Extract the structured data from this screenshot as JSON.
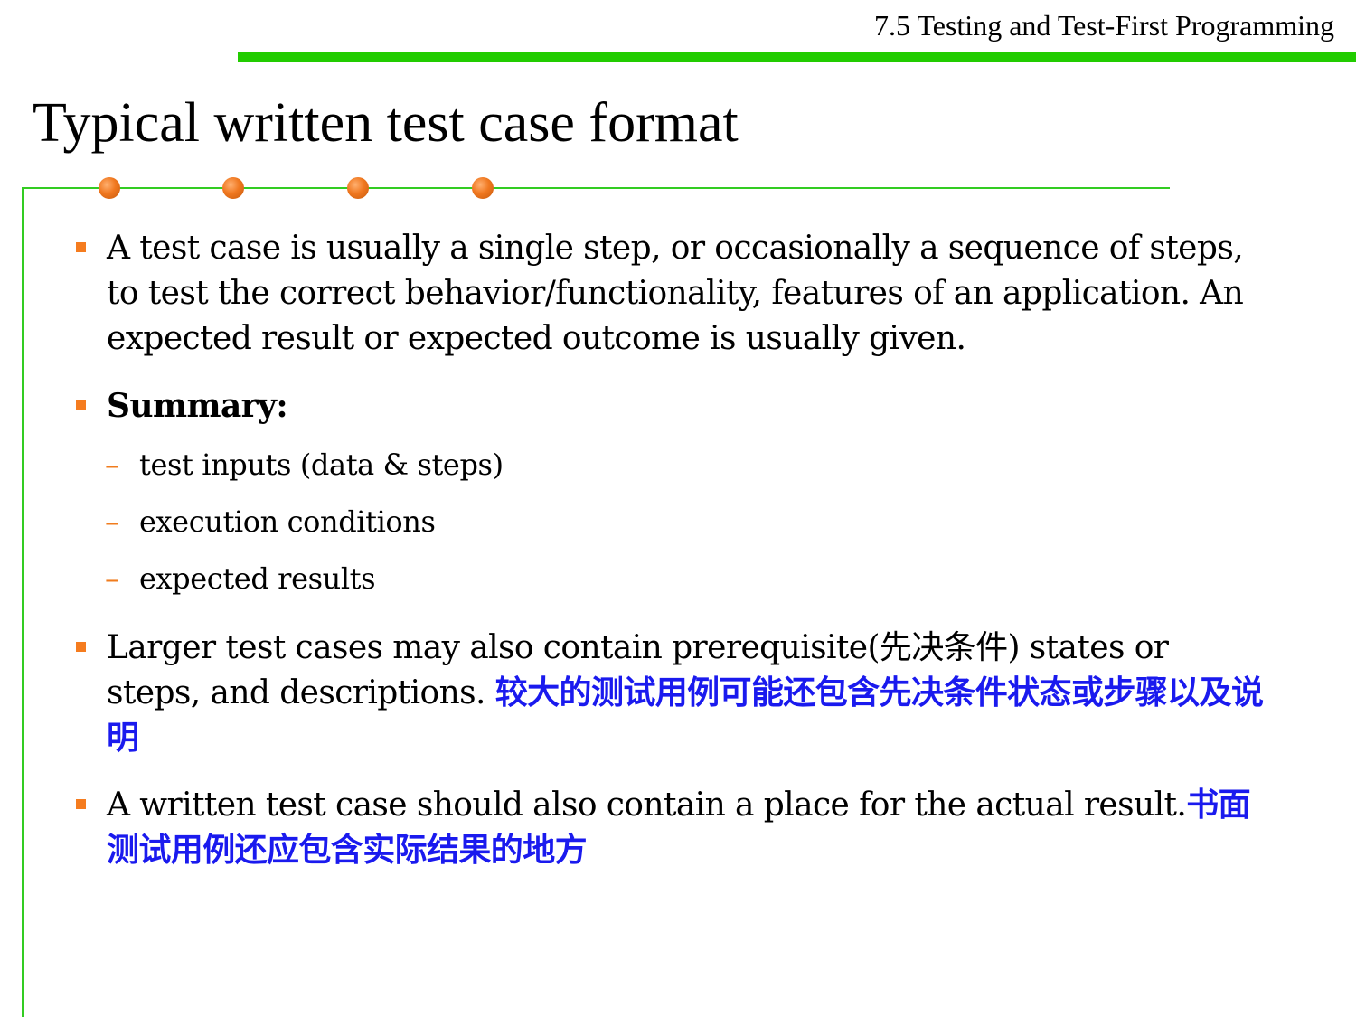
{
  "header": {
    "section_title": "7.5 Testing and Test-First Programming",
    "bar_color": "#22cc00"
  },
  "slide": {
    "title": "Typical written test case format"
  },
  "bullets": {
    "b1": {
      "text": "A test case is usually a single step, or occasionally a sequence of steps, to test the correct behavior/functionality, features of an application. An expected result or expected outcome is usually given."
    },
    "b2": {
      "text": "Summary:",
      "subitems": [
        "test inputs (data & steps)",
        "execution conditions",
        "expected results"
      ]
    },
    "b3": {
      "text": "Larger test cases may also contain prerequisite(先决条件) states or steps, and descriptions. ",
      "translation": "较大的测试用例可能还包含先决条件状态或步骤以及说明"
    },
    "b4": {
      "text": "A written test case should also contain a place for the actual result.",
      "translation": "书面测试用例还应包含实际结果的地方"
    }
  },
  "colors": {
    "accent_green": "#33cc22",
    "bullet_orange": "#f57c1f",
    "translation_blue": "#1a1aee"
  }
}
